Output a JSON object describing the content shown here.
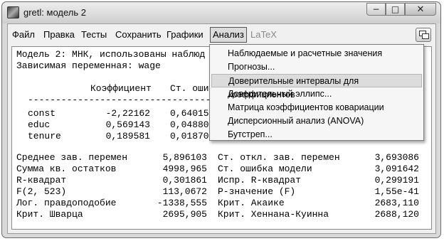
{
  "window": {
    "title": "gretl: модель 2",
    "buttons": {
      "minimize": "−",
      "maximize": "□",
      "close": "✕"
    }
  },
  "menubar": {
    "items": [
      {
        "label": "Файл"
      },
      {
        "label": "Правка"
      },
      {
        "label": "Тесты"
      },
      {
        "label": "Сохранить"
      },
      {
        "label": "Графики"
      },
      {
        "label": "Анализ",
        "active": true
      },
      {
        "label": "LaTeX",
        "disabled": true
      }
    ]
  },
  "output": {
    "header1": "Модель 2: МНК, использованы наблюд",
    "header2": "Зависимая переменная: wage",
    "col_coef": "Коэффициент",
    "col_se": "Ст. оши",
    "rule": "--------------------------------------",
    "rows": [
      {
        "name": "const",
        "coef": "-2,22162",
        "se": "0,64015"
      },
      {
        "name": "educ",
        "coef": "0,569143",
        "se": "0,04880"
      },
      {
        "name": "tenure",
        "coef": "0,189581",
        "se": "0,01870"
      }
    ],
    "stats": [
      {
        "l_label": "Среднее зав. перемен",
        "l_value": "5,896103",
        "r_label": "Ст. откл. зав. перемен",
        "r_value": "3,693086"
      },
      {
        "l_label": "Сумма кв. остатков",
        "l_value": "4998,965",
        "r_label": "Ст. ошибка модели",
        "r_value": "3,091642"
      },
      {
        "l_label": "R-квадрат",
        "l_value": "0,301861",
        "r_label": "Испр. R-квадрат",
        "r_value": "0,299191"
      },
      {
        "l_label": "F(2, 523)",
        "l_value": "113,0672",
        "r_label": "Р-значение (F)",
        "r_value": "1,55e-41"
      },
      {
        "l_label": "Лог. правдоподобие",
        "l_value": "-1338,555",
        "r_label": "Крит. Акаике",
        "r_value": "2683,110"
      },
      {
        "l_label": "Крит. Шварца",
        "l_value": "2695,905",
        "r_label": "Крит. Хеннана-Куинна",
        "r_value": "2688,120"
      }
    ]
  },
  "dropdown": {
    "items": [
      {
        "label": "Наблюдаемые и расчетные значения"
      },
      {
        "label": "Прогнозы..."
      },
      {
        "label": "Доверительные интервалы для коэффициентов",
        "highlighted": true
      },
      {
        "label": "Доверительный эллипс..."
      },
      {
        "label": "Матрица коэффициентов ковариации"
      },
      {
        "label": "Дисперсионный анализ (ANOVA)"
      },
      {
        "label": "Бутстреп..."
      }
    ]
  }
}
